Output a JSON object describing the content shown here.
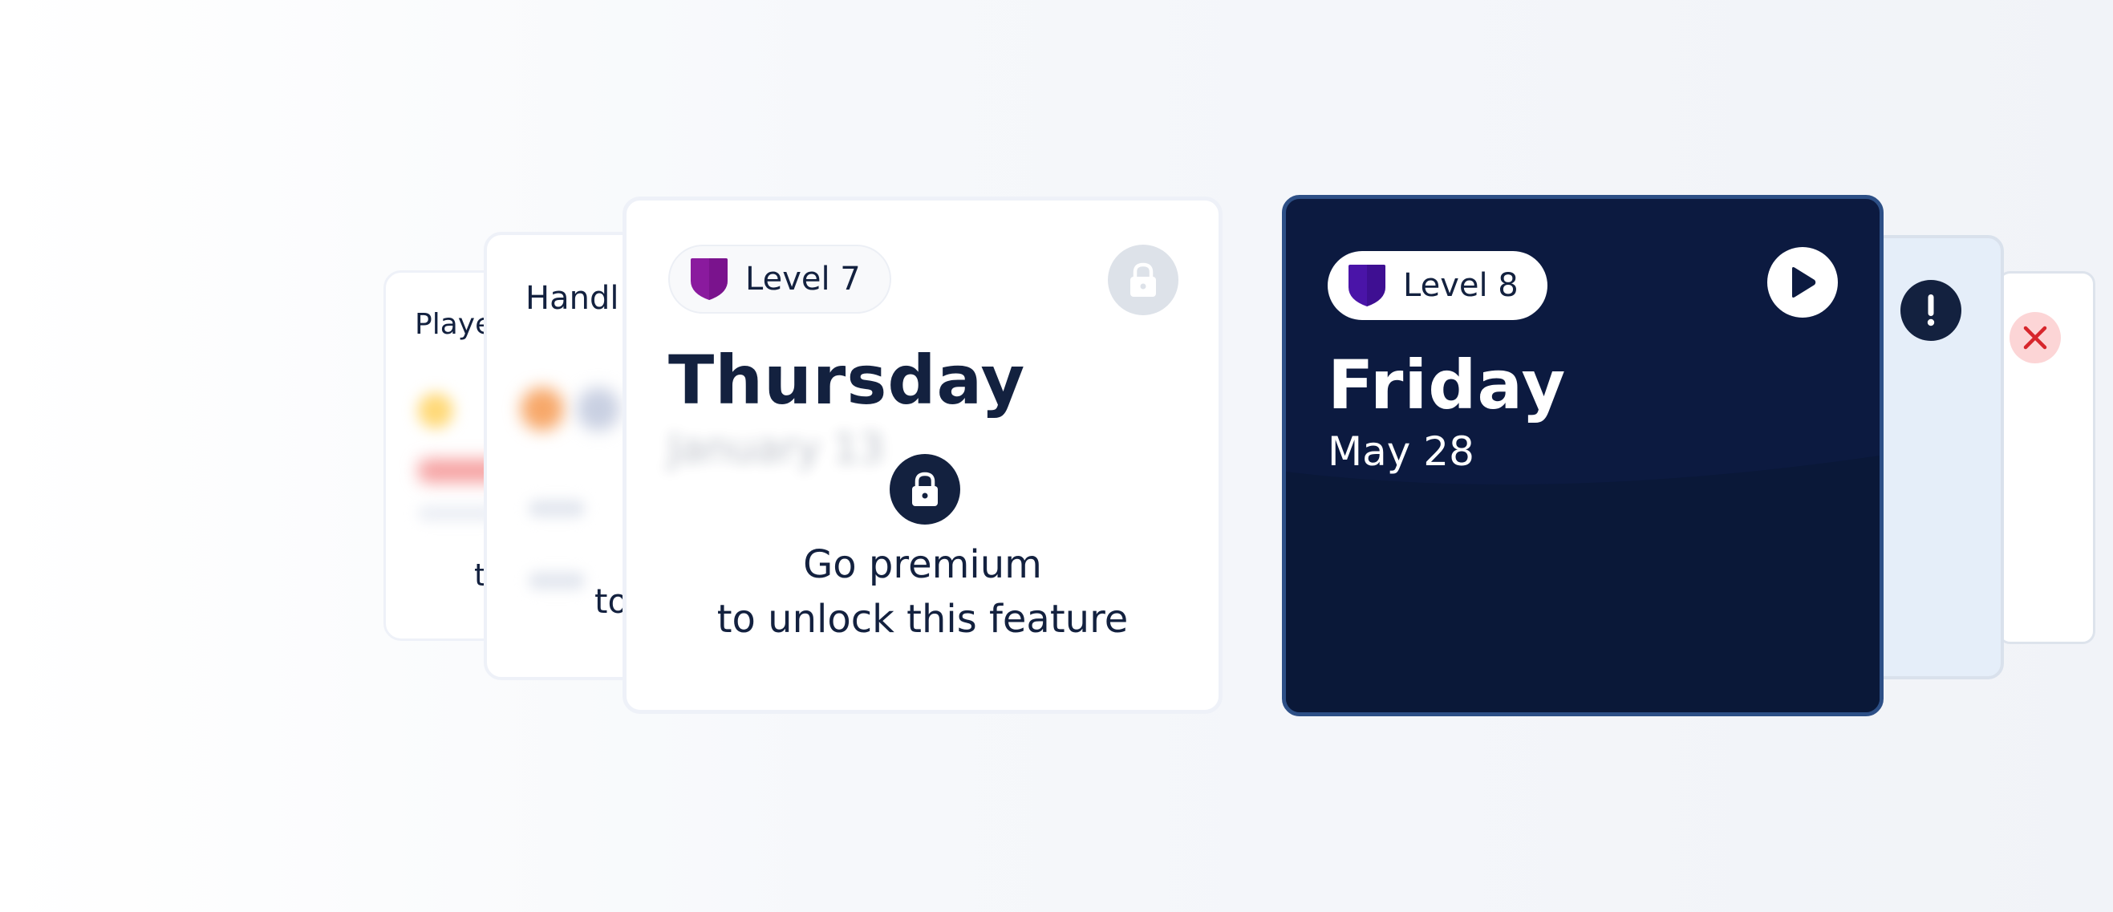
{
  "cards": {
    "player": {
      "title": "Playe",
      "fragment": "t"
    },
    "handling": {
      "title": "Handl",
      "fragment": "to"
    },
    "thursday": {
      "level_label": "Level 7",
      "day": "Thursday",
      "date_blurred": "January 13",
      "premium_line1": "Go premium",
      "premium_line2": "to unlock this feature",
      "shield_color": "#8a1a9e",
      "lock_icon": "lock-icon"
    },
    "friday": {
      "level_label": "Level 8",
      "day": "Friday",
      "date": "May 28",
      "shield_color": "#4a14a8",
      "background": "#0c1a40",
      "action_icon": "play-icon"
    },
    "alert_card": {
      "icon": "exclamation-icon",
      "color": "#13213f"
    },
    "error_card": {
      "icon": "close-icon",
      "color": "#d7262c"
    }
  }
}
